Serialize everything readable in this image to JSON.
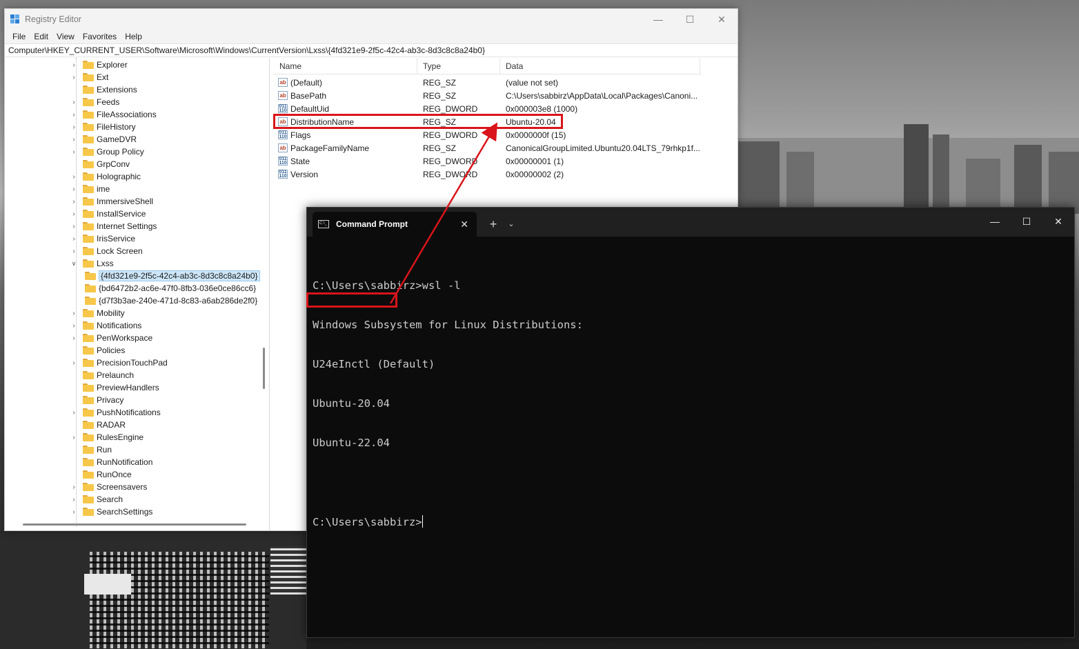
{
  "regedit": {
    "title": "Registry Editor",
    "menu": [
      "File",
      "Edit",
      "View",
      "Favorites",
      "Help"
    ],
    "address": "Computer\\HKEY_CURRENT_USER\\Software\\Microsoft\\Windows\\CurrentVersion\\Lxss\\{4fd321e9-2f5c-42c4-ab3c-8d3c8c8a24b0}",
    "tree": [
      {
        "label": "Explorer",
        "expandable": true
      },
      {
        "label": "Ext",
        "expandable": true
      },
      {
        "label": "Extensions",
        "expandable": false
      },
      {
        "label": "Feeds",
        "expandable": true
      },
      {
        "label": "FileAssociations",
        "expandable": true
      },
      {
        "label": "FileHistory",
        "expandable": true
      },
      {
        "label": "GameDVR",
        "expandable": true
      },
      {
        "label": "Group Policy",
        "expandable": true
      },
      {
        "label": "GrpConv",
        "expandable": false
      },
      {
        "label": "Holographic",
        "expandable": true
      },
      {
        "label": "ime",
        "expandable": true
      },
      {
        "label": "ImmersiveShell",
        "expandable": true
      },
      {
        "label": "InstallService",
        "expandable": true
      },
      {
        "label": "Internet Settings",
        "expandable": true
      },
      {
        "label": "IrisService",
        "expandable": true
      },
      {
        "label": "Lock Screen",
        "expandable": true
      },
      {
        "label": "Lxss",
        "expandable": true,
        "expanded": true
      },
      {
        "label": "{4fd321e9-2f5c-42c4-ab3c-8d3c8c8a24b0}",
        "child": true,
        "selected": true
      },
      {
        "label": "{bd6472b2-ac6e-47f0-8fb3-036e0ce86cc6}",
        "child": true
      },
      {
        "label": "{d7f3b3ae-240e-471d-8c83-a6ab286de2f0}",
        "child": true
      },
      {
        "label": "Mobility",
        "expandable": true
      },
      {
        "label": "Notifications",
        "expandable": true
      },
      {
        "label": "PenWorkspace",
        "expandable": true
      },
      {
        "label": "Policies",
        "expandable": false
      },
      {
        "label": "PrecisionTouchPad",
        "expandable": true
      },
      {
        "label": "Prelaunch",
        "expandable": false
      },
      {
        "label": "PreviewHandlers",
        "expandable": false
      },
      {
        "label": "Privacy",
        "expandable": false
      },
      {
        "label": "PushNotifications",
        "expandable": true
      },
      {
        "label": "RADAR",
        "expandable": false
      },
      {
        "label": "RulesEngine",
        "expandable": true
      },
      {
        "label": "Run",
        "expandable": false
      },
      {
        "label": "RunNotification",
        "expandable": false
      },
      {
        "label": "RunOnce",
        "expandable": false
      },
      {
        "label": "Screensavers",
        "expandable": true
      },
      {
        "label": "Search",
        "expandable": true
      },
      {
        "label": "SearchSettings",
        "expandable": true
      }
    ],
    "columns": {
      "name": "Name",
      "type": "Type",
      "data": "Data"
    },
    "values": [
      {
        "icon": "sz",
        "name": "(Default)",
        "type": "REG_SZ",
        "data": "(value not set)"
      },
      {
        "icon": "sz",
        "name": "BasePath",
        "type": "REG_SZ",
        "data": "C:\\Users\\sabbirz\\AppData\\Local\\Packages\\Canoni..."
      },
      {
        "icon": "dword",
        "name": "DefaultUid",
        "type": "REG_DWORD",
        "data": "0x000003e8 (1000)"
      },
      {
        "icon": "sz",
        "name": "DistributionName",
        "type": "REG_SZ",
        "data": "Ubuntu-20.04"
      },
      {
        "icon": "dword",
        "name": "Flags",
        "type": "REG_DWORD",
        "data": "0x0000000f (15)"
      },
      {
        "icon": "sz",
        "name": "PackageFamilyName",
        "type": "REG_SZ",
        "data": "CanonicalGroupLimited.Ubuntu20.04LTS_79rhkp1f..."
      },
      {
        "icon": "dword",
        "name": "State",
        "type": "REG_DWORD",
        "data": "0x00000001 (1)"
      },
      {
        "icon": "dword",
        "name": "Version",
        "type": "REG_DWORD",
        "data": "0x00000002 (2)"
      }
    ]
  },
  "cmd": {
    "tab_title": "Command Prompt",
    "tab_icon_text": "C:\\_",
    "lines": [
      "C:\\Users\\sabbirz>wsl -l",
      "Windows Subsystem for Linux Distributions:",
      "U24eInctl (Default)",
      "Ubuntu-20.04",
      "Ubuntu-22.04",
      "",
      "C:\\Users\\sabbirz>"
    ]
  },
  "colors": {
    "highlight": "#d9141a",
    "terminal_bg": "#0c0c0c",
    "terminal_text": "#cccccc",
    "selection": "#cde6f7"
  }
}
